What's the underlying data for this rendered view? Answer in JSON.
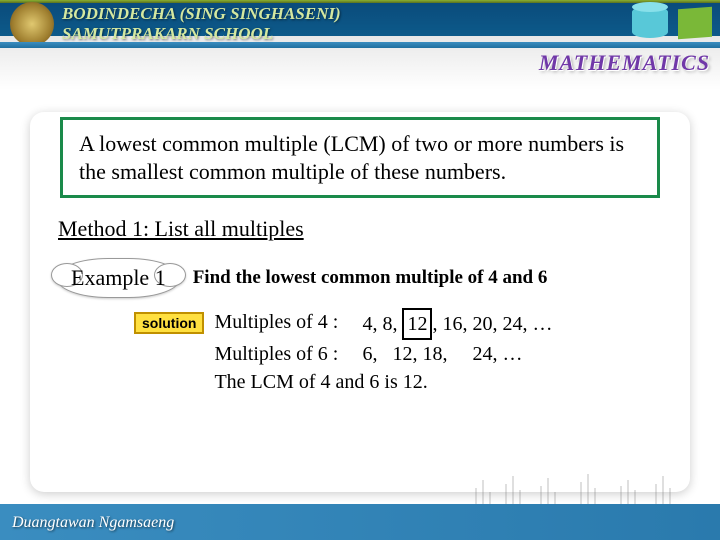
{
  "header": {
    "school_line1": "BODINDECHA (SING SINGHASENI)",
    "school_line2": "SAMUTPRAKARN  SCHOOL",
    "subject": "MATHEMATICS"
  },
  "definition": "A lowest common multiple (LCM) of  two or more numbers is the smallest common multiple of these numbers.",
  "method_heading": "Method 1: List all multiples",
  "example": {
    "label": "Example 1",
    "prompt": "Find the lowest common multiple of 4 and  6",
    "solution_label": "solution",
    "mult4_label": "Multiples of 4 :",
    "mult4_values": "4, 8, 12, 16, 20, 24, …",
    "mult6_label": "Multiples of 6 :",
    "mult6_values": "6,   12, 18,     24, …",
    "conclusion": "The LCM of 4 and 6 is 12.",
    "boxed_value": "12"
  },
  "footer": {
    "author": "Duangtawan  Ngamsaeng"
  }
}
